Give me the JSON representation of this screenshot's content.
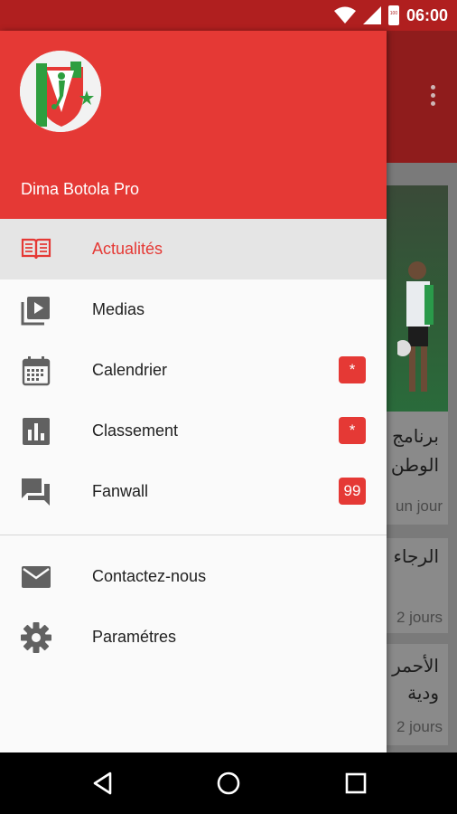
{
  "status_bar": {
    "time": "06:00",
    "battery_text": "100"
  },
  "drawer": {
    "app_name": "Dima Botola Pro",
    "items": [
      {
        "label": "Actualités",
        "icon": "newspaper-icon",
        "active": true
      },
      {
        "label": "Medias",
        "icon": "video-library-icon"
      },
      {
        "label": "Calendrier",
        "icon": "calendar-icon",
        "badge": "*"
      },
      {
        "label": "Classement",
        "icon": "bar-chart-icon",
        "badge": "*"
      },
      {
        "label": "Fanwall",
        "icon": "chat-icon",
        "badge": "99"
      }
    ],
    "secondary_items": [
      {
        "label": "Contactez-nous",
        "icon": "mail-icon"
      },
      {
        "label": "Paramétres",
        "icon": "settings-icon"
      }
    ]
  },
  "background_feed": {
    "cards": [
      {
        "title_line1": "برنامج",
        "title_line2": "الوطن",
        "meta": "un jour"
      },
      {
        "title_line1": "الرجاء",
        "meta": "2 jours"
      },
      {
        "title_line1": "الأحمر",
        "title_line2": "ودية",
        "meta": "2 jours"
      }
    ]
  },
  "colors": {
    "primary": "#e53935",
    "primary_dark": "#b01f1f",
    "active_bg": "#e5e5e5"
  }
}
